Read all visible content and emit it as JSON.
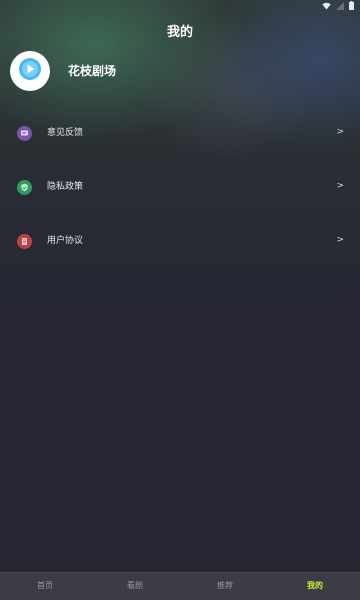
{
  "header": {
    "title": "我的"
  },
  "status_bar": {
    "icons": [
      "signal-icon",
      "wifi-icon",
      "battery-icon"
    ]
  },
  "profile": {
    "app_name": "花枝剧场",
    "avatar_icon": "play-icon",
    "avatar_accent": "#45b8f2"
  },
  "menu": {
    "items": [
      {
        "label": "意见反馈",
        "icon": "feedback-icon",
        "icon_color": "#7a55a8",
        "chevron": ">"
      },
      {
        "label": "隐私政策",
        "icon": "shield-icon",
        "icon_color": "#2f9a62",
        "chevron": ">"
      },
      {
        "label": "用户协议",
        "icon": "document-icon",
        "icon_color": "#c04048",
        "chevron": ">"
      }
    ]
  },
  "tabs": [
    {
      "label": "首页",
      "active": false
    },
    {
      "label": "看剧",
      "active": false
    },
    {
      "label": "推荐",
      "active": false
    },
    {
      "label": "我的",
      "active": true
    }
  ],
  "colors": {
    "background": "#262733",
    "tab_bar": "#3b3c45",
    "active_tab": "#c6ee3d",
    "inactive_tab": "#9a9aa5"
  }
}
